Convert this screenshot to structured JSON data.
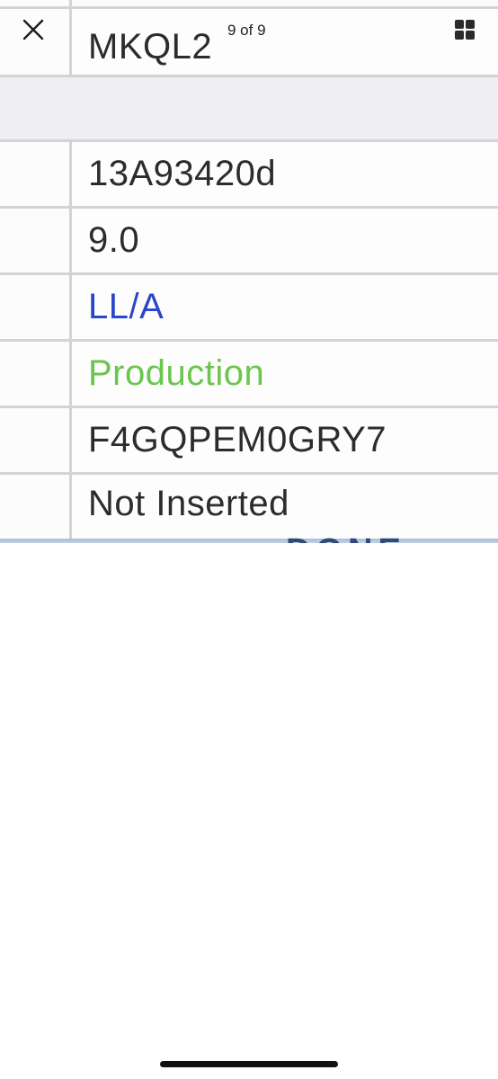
{
  "viewer": {
    "counter": "9 of 9",
    "close_icon": "close-icon",
    "grid_icon": "grid-view-icon"
  },
  "photo_table": {
    "header_value": "MKQL2",
    "rows": [
      {
        "value": "13A93420d",
        "color": "#2c2c2e"
      },
      {
        "value": "9.0",
        "color": "#2c2c2e"
      },
      {
        "value": "LL/A",
        "color": "#2a46c8"
      },
      {
        "value": "Production",
        "color": "#6cc54d"
      },
      {
        "value": "F4GQPEM0GRY7",
        "color": "#2c2c2e"
      },
      {
        "value": "Not Inserted",
        "color": "#2c2c2e"
      }
    ],
    "cut_off_text": "DONE"
  }
}
